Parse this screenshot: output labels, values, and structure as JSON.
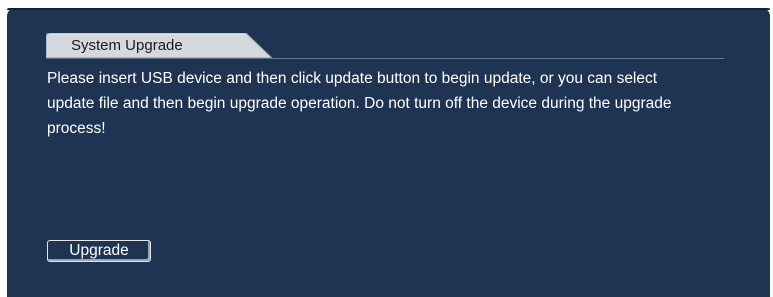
{
  "panel": {
    "tab_label": "System Upgrade",
    "description": "Please insert USB device and then click update button to begin update, or you can select update file and then begin upgrade operation. Do not turn off the device during the upgrade process!",
    "upgrade_label": "Upgrade"
  },
  "colors": {
    "background": "#1f3453",
    "tab_fill": "#cfd4dc",
    "text": "#ffffff"
  }
}
